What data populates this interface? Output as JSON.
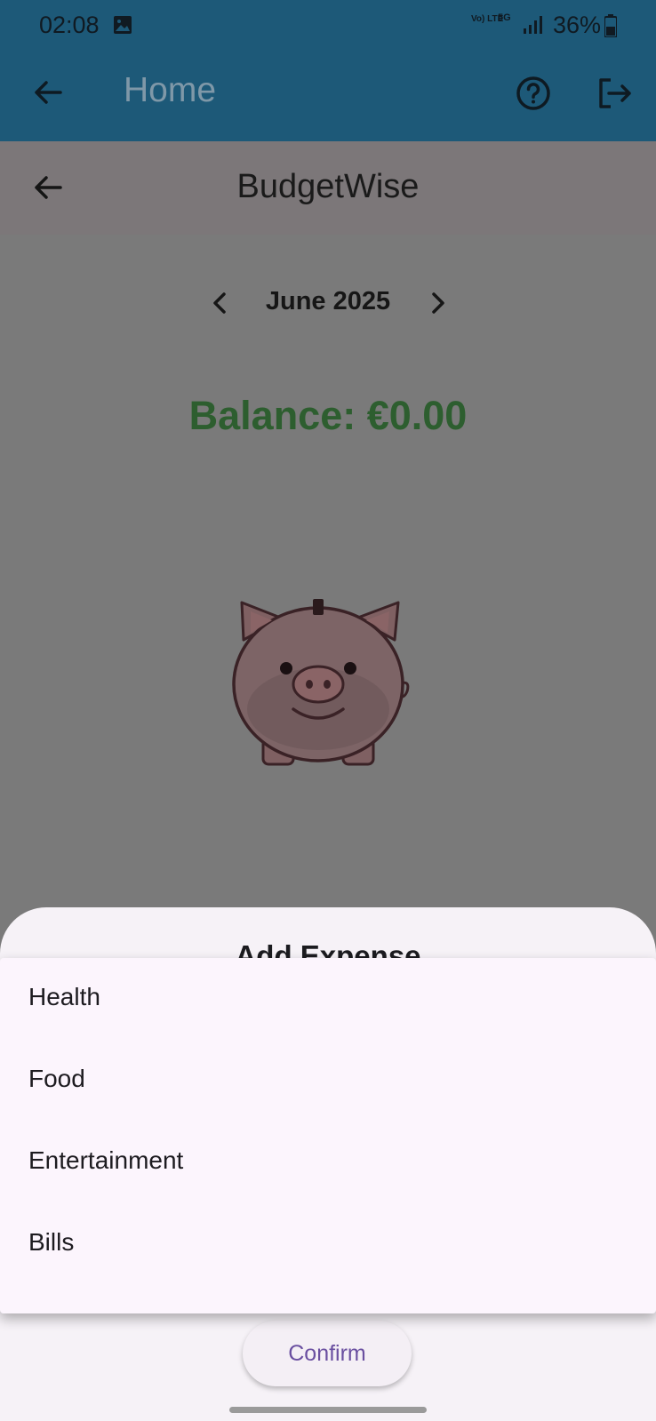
{
  "status_bar": {
    "time": "02:08",
    "volte_label": "Vo) LTE",
    "network_label": "5G",
    "battery": "36%",
    "icons": [
      "gallery-icon",
      "signal-icon",
      "battery-icon"
    ]
  },
  "app_bar": {
    "title": "Home",
    "icons": [
      "back-arrow-icon",
      "help-circle-icon",
      "logout-icon"
    ]
  },
  "page": {
    "title": "BudgetWise",
    "month": "June 2025",
    "balance": "Balance: €0.00",
    "balance_color": "#2d5e2f"
  },
  "sheet": {
    "title": "Add Expense",
    "confirm_label": "Confirm",
    "accent_color": "#6a4fa0"
  },
  "menu": {
    "items": [
      {
        "label": "Health"
      },
      {
        "label": "Food"
      },
      {
        "label": "Entertainment"
      },
      {
        "label": "Bills"
      }
    ]
  }
}
